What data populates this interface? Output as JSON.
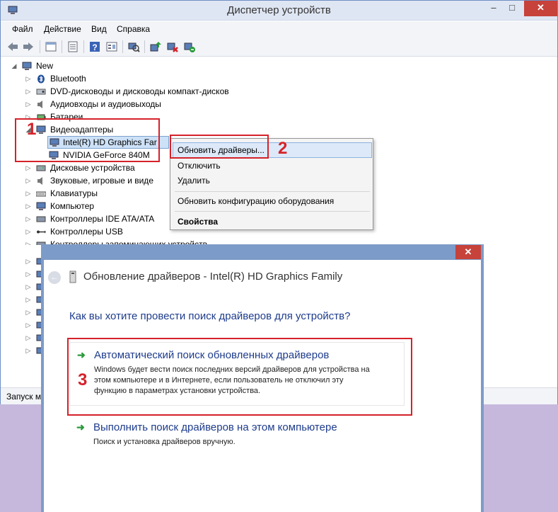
{
  "window": {
    "title": "Диспетчер устройств",
    "minimize_glyph": "–",
    "maximize_glyph": "□",
    "close_glyph": "✕"
  },
  "menu": [
    "Файл",
    "Действие",
    "Вид",
    "Справка"
  ],
  "toolbar_icons": [
    "back-arrow-icon",
    "forward-arrow-icon",
    "properties-icon",
    "show-hidden-icon",
    "help-icon",
    "console-tree-icon",
    "scan-hardware-icon",
    "update-driver-icon",
    "disable-device-icon",
    "uninstall-device-icon"
  ],
  "tree": {
    "root": "New",
    "items": [
      {
        "label": "Bluetooth"
      },
      {
        "label": "DVD-дисководы и дисководы компакт-дисков"
      },
      {
        "label": "Аудиовходы и аудиовыходы"
      },
      {
        "label": "Батареи"
      },
      {
        "label": "Видеоадаптеры",
        "expanded": true
      },
      {
        "label": "Intel(R) HD Graphics Far",
        "child": true,
        "selected": true
      },
      {
        "label": "NVIDIA GeForce 840M",
        "child": true
      },
      {
        "label": "Дисковые устройства"
      },
      {
        "label": "Звуковые, игровые и виде"
      },
      {
        "label": "Клавиатуры"
      },
      {
        "label": "Компьютер"
      },
      {
        "label": "Контроллеры IDE ATA/ATA"
      },
      {
        "label": "Контроллеры USB"
      },
      {
        "label": "Контроллеры запоминающих устройств"
      }
    ]
  },
  "status_text": "Запуск м",
  "context_menu": {
    "items": [
      "Обновить драйверы...",
      "Отключить",
      "Удалить",
      "Обновить конфигурацию оборудования",
      "Свойства"
    ]
  },
  "annotations": {
    "n1": "1",
    "n2": "2",
    "n3": "3"
  },
  "dialog": {
    "close_glyph": "✕",
    "back_glyph": "←",
    "title": "Обновление драйверов - Intel(R) HD Graphics Family",
    "question": "Как вы хотите провести поиск драйверов для устройств?",
    "option_auto": {
      "title": "Автоматический поиск обновленных драйверов",
      "desc_1": "Windows будет вести поиск последних версий драйверов для устройства на",
      "desc_2": "этом компьютере и в Интернете, если пользователь не отключил эту",
      "desc_3": "функцию в параметрах установки устройства."
    },
    "option_manual": {
      "title": "Выполнить поиск драйверов на этом компьютере",
      "desc": "Поиск и установка драйверов вручную."
    },
    "arrow_glyph": "➜"
  },
  "colors": {
    "accent_red": "#d5222a",
    "link_blue": "#1e3c8c",
    "green_arrow": "#2a9a3a",
    "desktop_bg": "#c6b8dc"
  }
}
